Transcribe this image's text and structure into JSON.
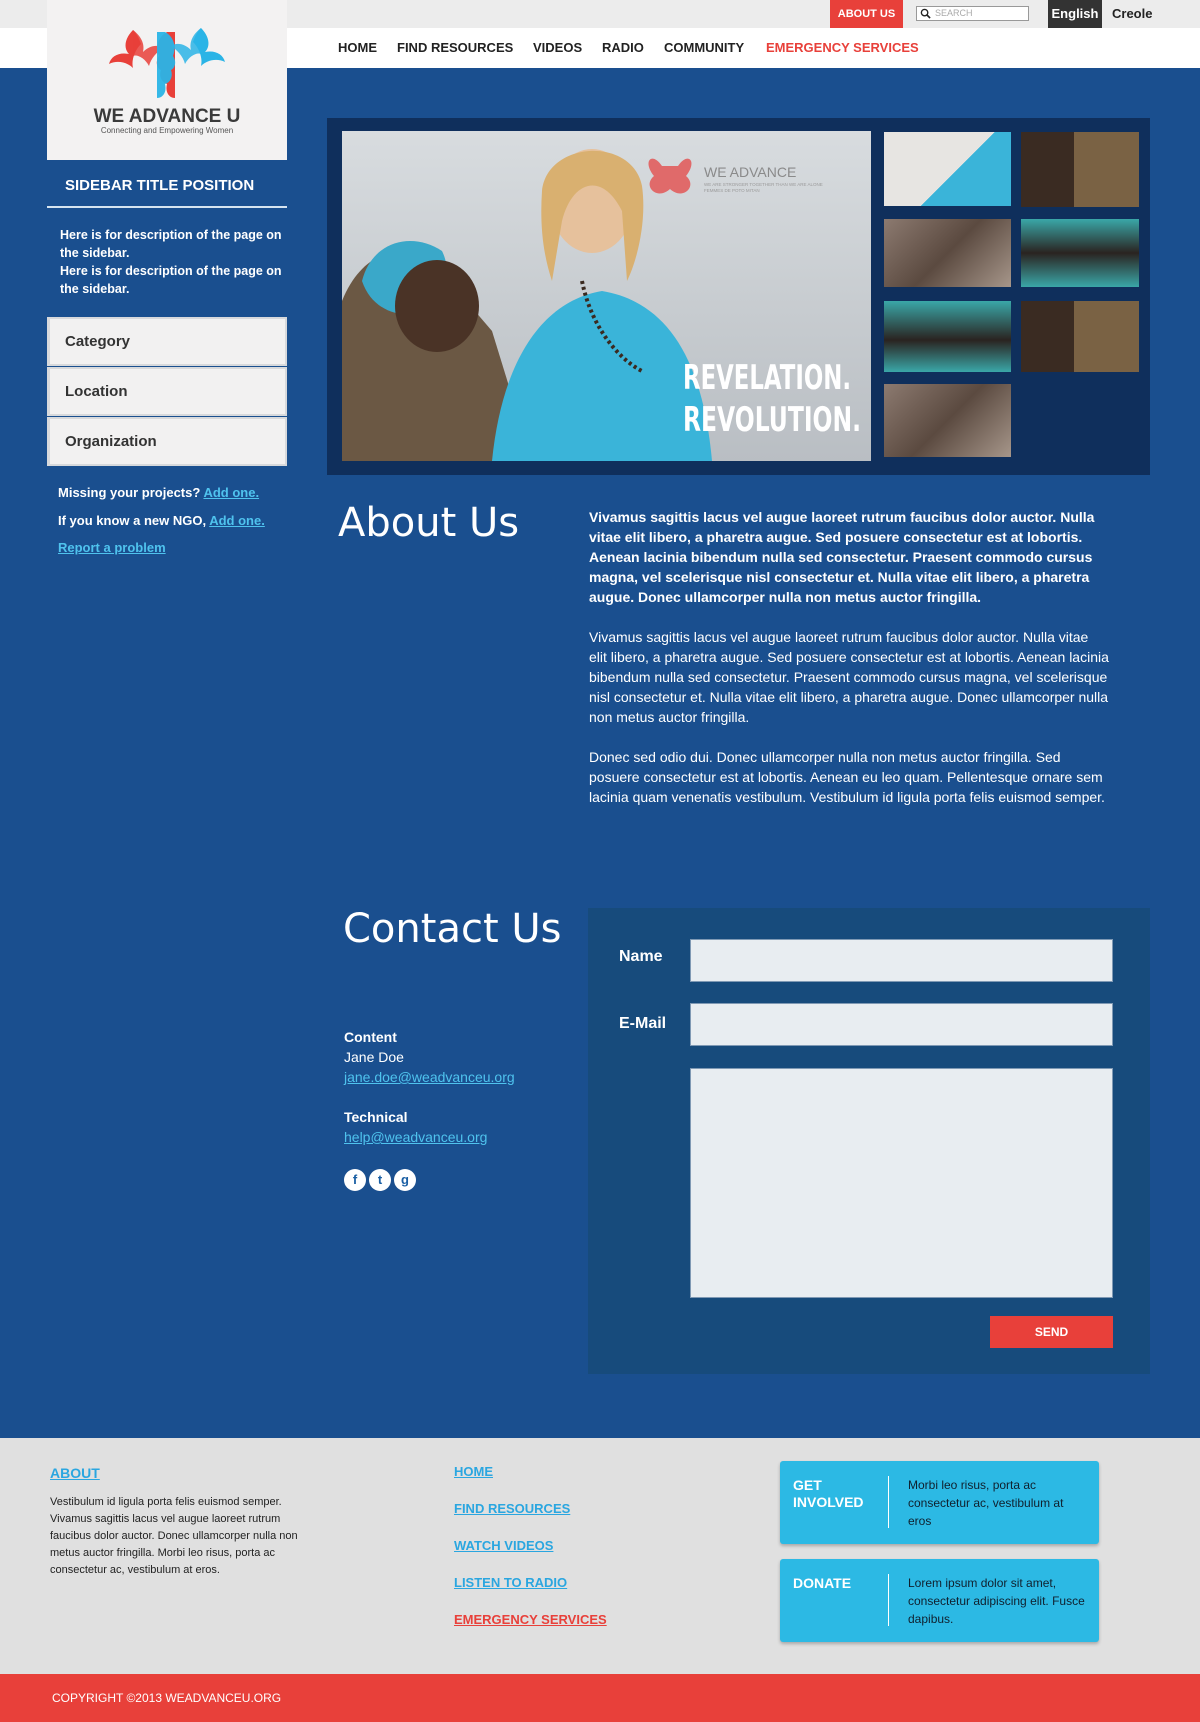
{
  "topbar": {
    "about_label": "ABOUT US",
    "search_placeholder": "SEARCH",
    "lang_primary": "English",
    "lang_secondary": "Creole"
  },
  "nav": {
    "items": [
      "HOME",
      "FIND RESOURCES",
      "VIDEOS",
      "RADIO",
      "COMMUNITY"
    ],
    "emergency": "EMERGENCY SERVICES"
  },
  "logo": {
    "name": "WE ADVANCE U",
    "tagline": "Connecting and Empowering Women"
  },
  "sidebar": {
    "title": "SIDEBAR TITLE POSITION",
    "desc1": "Here is for description of the page on the sidebar.",
    "desc2": "Here is for description of the page on the sidebar.",
    "menu": [
      "Category",
      "Location",
      "Organization"
    ],
    "missing_text": "Missing your projects?",
    "missing_link": "Add one.",
    "ngo_text": "If you know a new NGO,",
    "ngo_link": "Add one.",
    "report_link": "Report a problem"
  },
  "hero": {
    "brand": "WE ADVANCE",
    "brand_sub": "WE ARE STRONGER TOGETHER THAN WE ARE ALONE",
    "brand_sub2": "FEMMES DE POTO MITAN",
    "headline1": "REVELATION.",
    "headline2": "REVOLUTION."
  },
  "about": {
    "heading": "About Us",
    "lead": "Vivamus sagittis lacus vel augue laoreet rutrum faucibus dolor auctor. Nulla vitae elit libero, a pharetra augue. Sed posuere consectetur est at lobortis. Aenean lacinia bibendum nulla sed consectetur. Praesent commodo cursus magna, vel scelerisque nisl consectetur et. Nulla vitae elit libero, a pharetra augue. Donec ullamcorper nulla non metus auctor fringilla.",
    "p1": "Vivamus sagittis lacus vel augue laoreet rutrum faucibus dolor auctor. Nulla vitae elit libero, a pharetra augue. Sed posuere consectetur est at lobortis. Aenean lacinia bibendum nulla sed consectetur. Praesent commodo cursus magna, vel scelerisque nisl consectetur et. Nulla vitae elit libero, a pharetra augue. Donec ullamcorper nulla non metus auctor fringilla.",
    "p2": "Donec sed odio dui. Donec ullamcorper nulla non metus auctor fringilla. Sed posuere consectetur est at lobortis. Aenean eu leo quam. Pellentesque ornare sem lacinia quam venenatis vestibulum. Vestibulum id ligula porta felis euismod semper."
  },
  "contact": {
    "heading": "Contact Us",
    "content_label": "Content",
    "content_name": "Jane Doe",
    "content_email": "jane.doe@weadvanceu.org",
    "tech_label": "Technical",
    "tech_email": "help@weadvanceu.org",
    "social": [
      "f",
      "t",
      "g"
    ],
    "form": {
      "name_label": "Name",
      "email_label": "E-Mail",
      "name_value": "",
      "email_value": "",
      "message_value": "",
      "send_label": "SEND"
    }
  },
  "footer": {
    "about_heading": "ABOUT",
    "about_text": "Vestibulum id ligula porta felis euismod semper. Vivamus sagittis lacus vel augue laoreet rutrum faucibus dolor auctor. Donec ullamcorper nulla non metus auctor fringilla. Morbi leo risus, porta ac consectetur ac, vestibulum at eros.",
    "links": [
      "HOME",
      "FIND RESOURCES",
      "WATCH VIDEOS",
      "LISTEN TO RADIO"
    ],
    "emergency_link": "EMERGENCY SERVICES",
    "cta1_title": "GET INVOLVED",
    "cta1_text": "Morbi leo risus, porta ac consectetur ac, vestibulum at eros",
    "cta2_title": "DONATE",
    "cta2_text": "Lorem ipsum dolor sit amet, consectetur adipiscing elit. Fusce dapibus.",
    "copyright": "COPYRIGHT ©2013 WEADVANCEU.ORG"
  },
  "colors": {
    "accent_red": "#e8403a",
    "link_blue": "#4fc3ee",
    "bg_blue": "#1a4f8f",
    "cta_blue": "#2cb9e4"
  }
}
